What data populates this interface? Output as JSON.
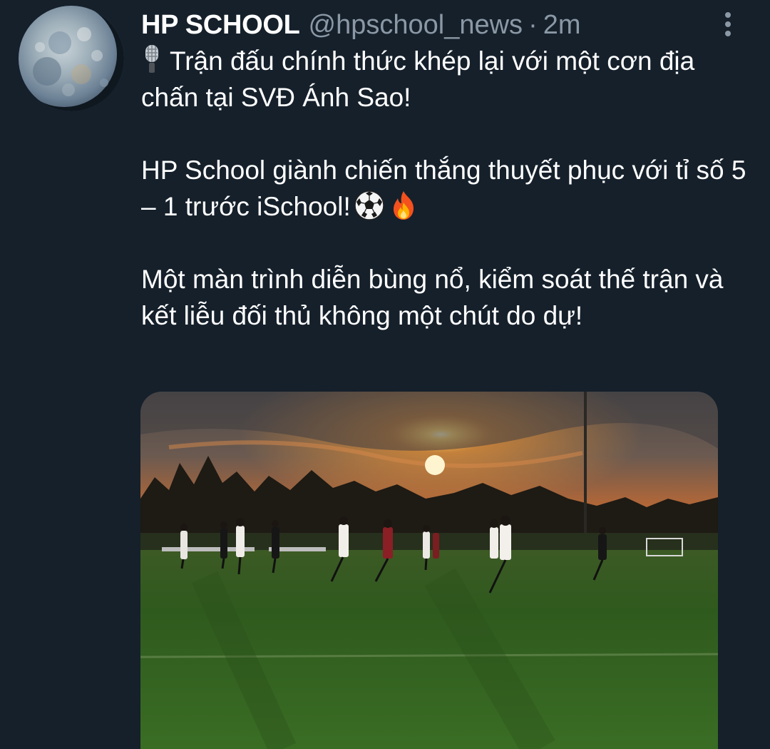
{
  "tweet": {
    "author": {
      "display_name": "HP SCHOOL",
      "handle": "@hpschool_news",
      "separator": "·",
      "time": "2m",
      "avatar_icon": "moon-avatar"
    },
    "text": {
      "line1": "Trận đấu chính thức khép lại với một cơn địa chấn tại SVĐ Ánh Sao!",
      "line2": "HP School giành chiến thắng thuyết phục với tỉ số 5 – 1 trước iSchool!",
      "line3": "Một màn trình diễn bùng nổ, kiểm soát thế trận và kết liễu đối thủ không một chút do dự!"
    },
    "icons": {
      "prefix": "microphone-icon",
      "emoji_1": "soccer-ball-icon",
      "emoji_2": "fire-icon",
      "menu": "more-vertical-icon"
    },
    "media": {
      "type": "photo",
      "subject": "soccer match at sunset"
    }
  },
  "colors": {
    "background": "#15202b",
    "text": "#ffffff",
    "muted": "#8b98a5"
  }
}
